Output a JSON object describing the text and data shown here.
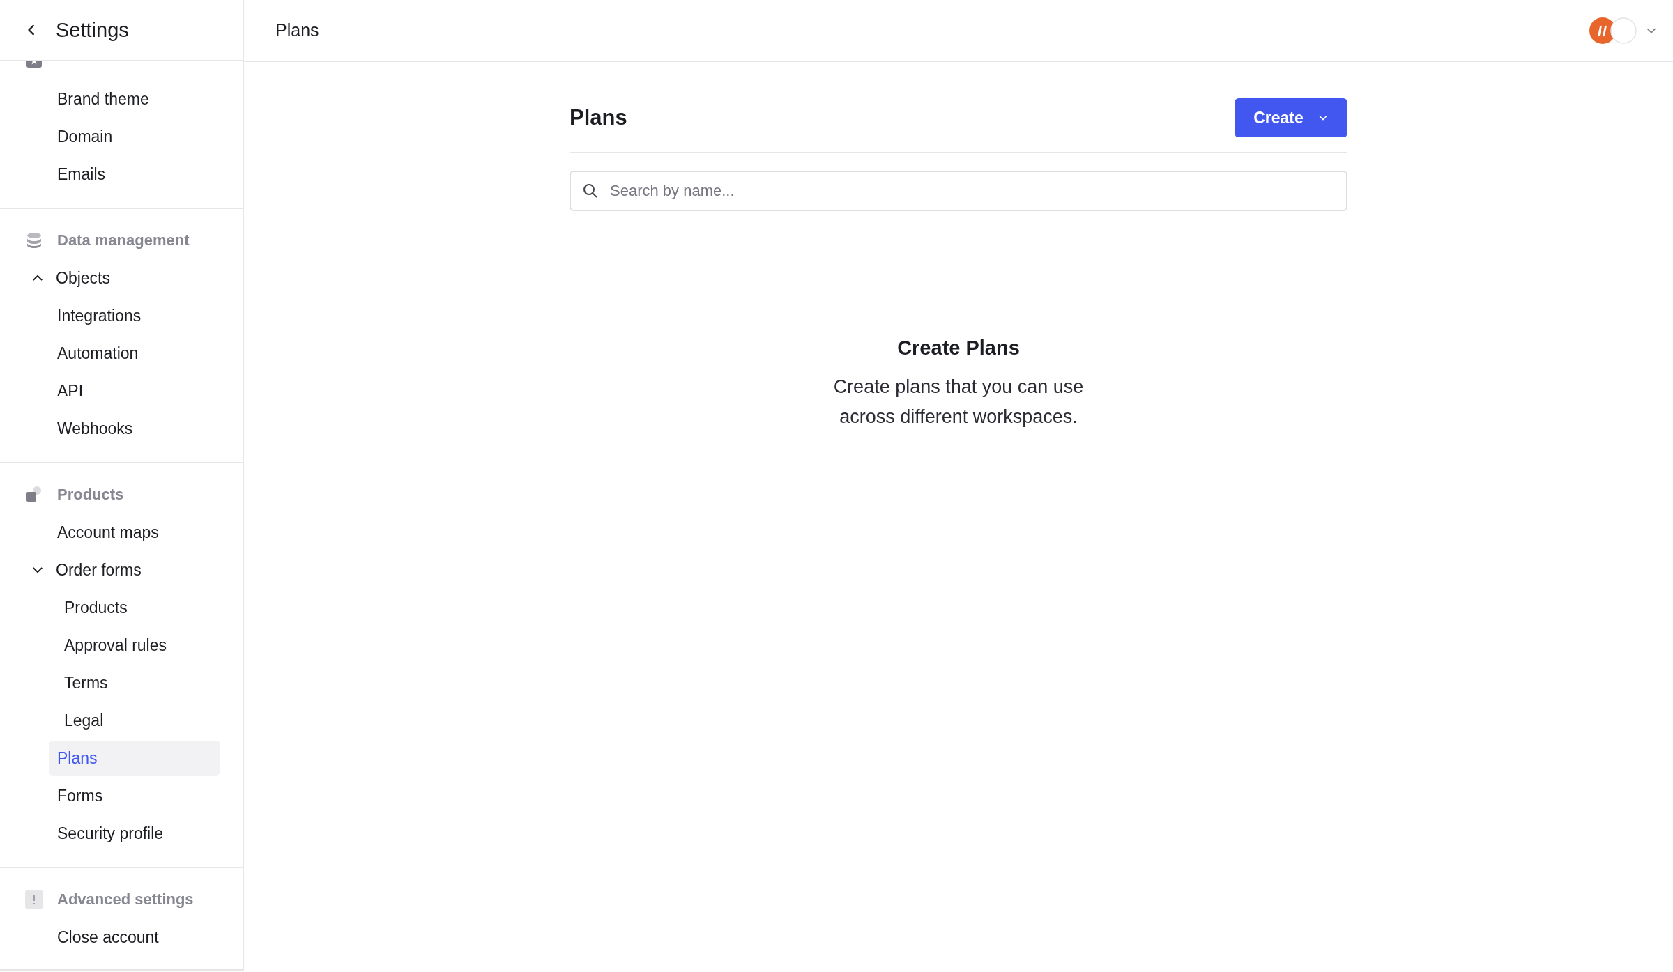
{
  "sidebar": {
    "title": "Settings",
    "sections": [
      {
        "items": [
          {
            "label": "Brand theme",
            "selected": false
          },
          {
            "label": "Domain",
            "selected": false
          },
          {
            "label": "Emails",
            "selected": false
          }
        ]
      },
      {
        "label": "Data management",
        "items": [
          {
            "label": "Objects",
            "kind": "group",
            "expanded": false
          },
          {
            "label": "Integrations",
            "selected": false
          },
          {
            "label": "Automation",
            "selected": false
          },
          {
            "label": "API",
            "selected": false
          },
          {
            "label": "Webhooks",
            "selected": false
          }
        ]
      },
      {
        "label": "Products",
        "items": [
          {
            "label": "Account maps",
            "selected": false
          },
          {
            "label": "Order forms",
            "kind": "group",
            "expanded": true,
            "children": [
              {
                "label": "Products",
                "selected": false
              },
              {
                "label": "Approval rules",
                "selected": false
              },
              {
                "label": "Terms",
                "selected": false
              },
              {
                "label": "Legal",
                "selected": false
              }
            ]
          },
          {
            "label": "Plans",
            "selected": true
          },
          {
            "label": "Forms",
            "selected": false
          },
          {
            "label": "Security profile",
            "selected": false
          }
        ]
      },
      {
        "label": "Advanced settings",
        "items": [
          {
            "label": "Close account",
            "selected": false
          }
        ]
      }
    ]
  },
  "header": {
    "title": "Plans"
  },
  "main": {
    "title": "Plans",
    "create_button": "Create",
    "search": {
      "placeholder": "Search by name..."
    },
    "empty_state": {
      "title": "Create Plans",
      "lines": [
        "Create plans that you can use",
        "across different workspaces."
      ]
    }
  }
}
